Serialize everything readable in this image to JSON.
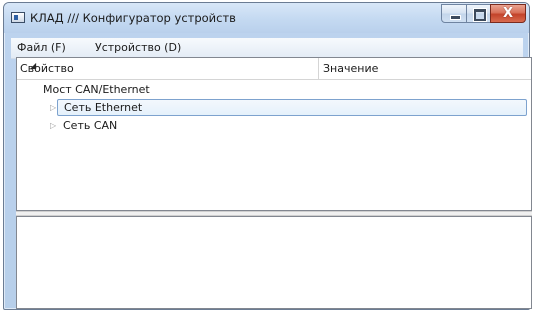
{
  "window": {
    "title": "КЛАД /// Конфигуратор устройств",
    "close_glyph": "X"
  },
  "menu": {
    "items": [
      {
        "label": "Файл (F)"
      },
      {
        "label": "Устройство (D)"
      }
    ]
  },
  "tree": {
    "columns": {
      "property": "Свойство",
      "value": "Значение"
    },
    "root": {
      "label": "Мост CAN/Ethernet",
      "expanded_glyph": "◢",
      "children": [
        {
          "label": "Сеть Ethernet",
          "glyph": "▷",
          "selected": true
        },
        {
          "label": "Сеть CAN",
          "glyph": "▷",
          "selected": false
        }
      ]
    }
  },
  "icons": {
    "app": "app-window-icon",
    "minimize": "minimize-icon",
    "maximize": "maximize-icon",
    "close": "close-icon"
  },
  "colors": {
    "selection_border": "#7da2ce",
    "close_button": "#c3432a",
    "frame": "#b7cfea"
  }
}
